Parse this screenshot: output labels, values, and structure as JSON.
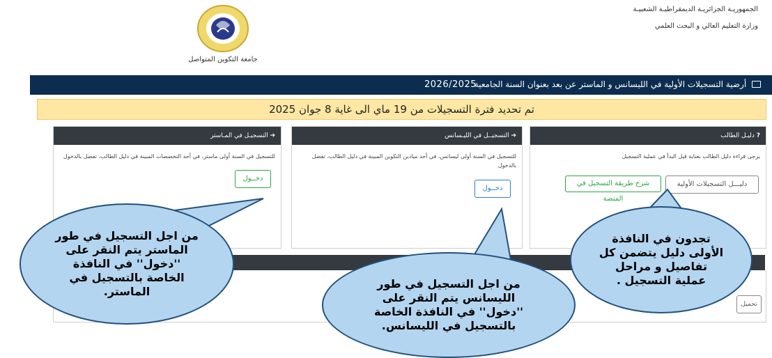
{
  "header": {
    "republic": "الجمهوريـة الجزائريـة الديمقراطيـة الشعبيـة",
    "ministry": "وزارة التعليم العالي و البحث العلمي",
    "university_name": "جامعة التكوين المتواصل",
    "logo_text": "جامعة التكوين المتواصل Université de la Formation Continue"
  },
  "topbar": {
    "title": "أرضية التسجيلات الأولية في الليسانس و الماستر عن بعد بعنوان السنة الجامعية",
    "year": "2026/2025"
  },
  "notice": "تم تحديد فترة التسجيلات من 19 ماي الى غاية 8 جوان 2025",
  "panels": {
    "guide": {
      "title": "دليـل الطالب",
      "text": "يرجى قراءة دليل الطالب بعناية قبل البدأ في عملية التسجيل",
      "btn_guide": "دليـــل التسجيلات الأولية",
      "btn_explain": "شرح طريقة التسجيل في المنصة"
    },
    "licence": {
      "title": "التسجيــل في الليـسانس",
      "text": "للتسجيل في السنة أولى ليسانس، في أحد ميادين التكوين المبينة في دليل الطالب، تفضل بالدخول",
      "btn": "دخــول"
    },
    "master": {
      "title": "التسجيـل في المـاستر",
      "text": "للتسجيل في السنة أولى ماستر، في أحد التخصصات المبينة في دليل الطالب، تفضل بالدخول",
      "btn": "دخــول"
    }
  },
  "lower": {
    "download_btn": "تحميل"
  },
  "callouts": {
    "master": "من اجل التسجيل في طور\nالماستر يتم النقر على\n''دخول'' في النافذة\nالخاصة بالتسجيل في\nالماستر.",
    "licence": "من اجل التسجيل في طور\nالليسانس يتم النقر على\n''دخول'' في النافذة الخاصة\nبالتسجيل في الليسانس.",
    "guide": "تجدون في النافذة\nالأولى دليل يتضمن كل\nتفاصيل و مراحل\nعملية التسجيل ."
  },
  "colors": {
    "topbar": "#0c2d4f",
    "notice_bg": "#fde7a3",
    "panel_header": "#343a40",
    "callout_fill": "#b3d5f0",
    "callout_border": "#24507d",
    "btn_green": "#28a745",
    "btn_blue": "#2a7bd8"
  }
}
